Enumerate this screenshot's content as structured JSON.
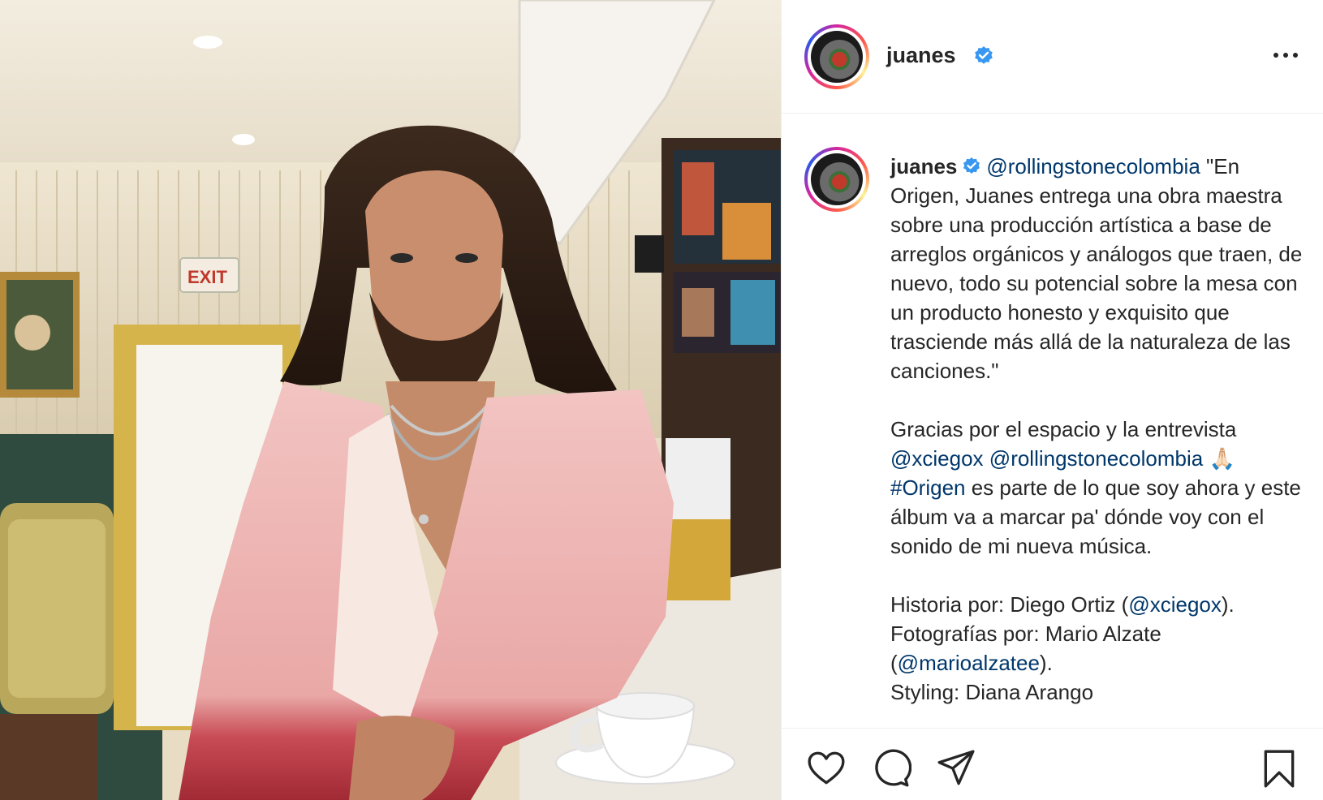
{
  "post": {
    "username": "juanes",
    "verified": true,
    "more_icon": "more-horizontal-icon",
    "caption": {
      "mention_1": "@rollingstonecolombia",
      "text_1": " \"En Origen, Juanes entrega una obra maestra sobre una producción artística a base de arreglos orgánicos y análogos que traen, de nuevo, todo su potencial sobre la mesa con un producto honesto y exquisito que trasciende más allá de la naturaleza de las canciones.\"",
      "text_2": "Gracias por el espacio y la entrevista",
      "mention_2": "@xciegox",
      "mention_3": "@rollingstonecolombia",
      "emoji": "🙏🏻",
      "hashtag": "#Origen",
      "text_3": " es parte de lo que soy ahora y este álbum va a marcar pa' dónde voy con el sonido de mi nueva música.",
      "text_4": "Historia por: Diego Ortiz (",
      "mention_4": "@xciegox",
      "text_5": ").",
      "text_6": "Fotografías por: Mario Alzate (",
      "mention_5": "@marioalzatee",
      "text_7": ").",
      "text_8": "Styling: Diana Arango"
    },
    "actions": {
      "like_icon": "heart-icon",
      "comment_icon": "comment-icon",
      "share_icon": "paper-plane-icon",
      "save_icon": "bookmark-icon"
    },
    "colors": {
      "link": "#00376b",
      "verified": "#3897f0",
      "text": "#262626",
      "border": "#efefef"
    }
  }
}
